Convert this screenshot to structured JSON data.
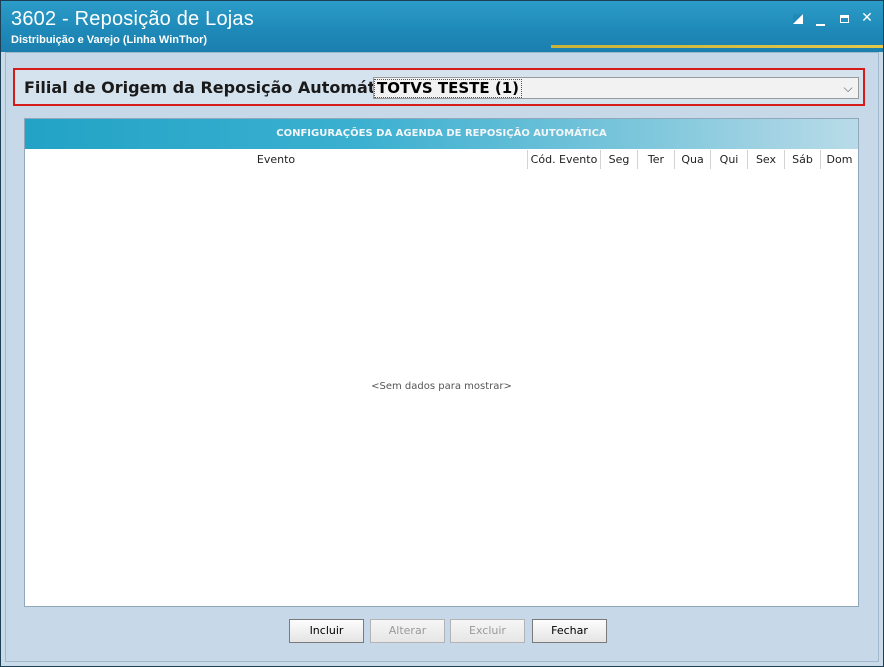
{
  "window": {
    "title": "3602 - Reposição de Lojas",
    "subtitle": "Distribuição e Varejo (Linha WinThor)",
    "controls": {
      "restore_icon": "restore-icon",
      "minimize_icon": "minimize-icon",
      "maximize_icon": "maximize-icon",
      "close_label": "✕"
    }
  },
  "filial": {
    "label": "Filial de Origem da Reposição Automática",
    "selected": "TOTVS TESTE (1)",
    "dropdown_arrow": "⌵"
  },
  "grid": {
    "title": "CONFIGURAÇÕES DA AGENDA DE REPOSIÇÃO AUTOMÁTICA",
    "columns": [
      "Evento",
      "Cód. Evento",
      "Seg",
      "Ter",
      "Qua",
      "Qui",
      "Sex",
      "Sáb",
      "Dom"
    ],
    "empty_message": "<Sem dados para mostrar>"
  },
  "buttons": {
    "incluir": "Incluir",
    "alterar": "Alterar",
    "excluir": "Excluir",
    "fechar": "Fechar"
  },
  "colors": {
    "title_bar": "#1f8ab9",
    "highlight_border": "#d61b1b",
    "grid_header": "#22a3c6"
  }
}
